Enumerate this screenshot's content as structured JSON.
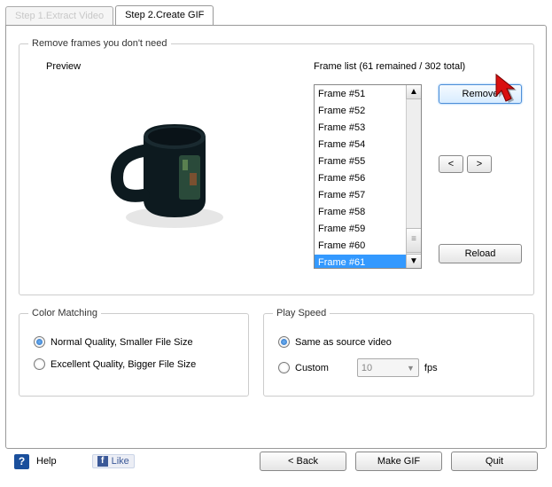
{
  "tabs": {
    "extract": "Step 1.Extract Video",
    "create": "Step 2.Create GIF"
  },
  "removeSection": {
    "legend": "Remove frames you don't need",
    "previewLabel": "Preview",
    "frameListLabel": "Frame list (61 remained / 302 total)",
    "frames": [
      "Frame #51",
      "Frame #52",
      "Frame #53",
      "Frame #54",
      "Frame #55",
      "Frame #56",
      "Frame #57",
      "Frame #58",
      "Frame #59",
      "Frame #60",
      "Frame #61"
    ],
    "selectedIndex": 10,
    "removeBtn": "Remove",
    "prevBtn": "<",
    "nextBtn": ">",
    "reloadBtn": "Reload"
  },
  "colorSection": {
    "legend": "Color Matching",
    "opt1": "Normal Quality, Smaller File Size",
    "opt2": "Excellent Quality, Bigger File Size",
    "selected": 0
  },
  "playSection": {
    "legend": "Play Speed",
    "opt1": "Same as source video",
    "opt2": "Custom",
    "customValue": "10",
    "fpsLabel": "fps",
    "selected": 0
  },
  "bottom": {
    "helpIcon": "?",
    "help": "Help",
    "fbF": "f",
    "like": "Like",
    "back": "< Back",
    "make": "Make GIF",
    "quit": "Quit"
  }
}
